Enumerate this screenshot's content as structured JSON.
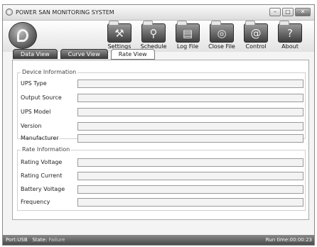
{
  "window": {
    "title": "POWER SAN MONITORING SYSTEM",
    "controls": [
      {
        "name": "minimize",
        "glyph": "–"
      },
      {
        "name": "maximize",
        "glyph": "□"
      },
      {
        "name": "close",
        "glyph": "✕"
      }
    ]
  },
  "toolbar": {
    "items": [
      {
        "label": "Settings",
        "icon": "settings-icon",
        "glyph": "⚒"
      },
      {
        "label": "Schedule",
        "icon": "schedule-icon",
        "glyph": "⚲"
      },
      {
        "label": "Log File",
        "icon": "log-file-icon",
        "glyph": "▤"
      },
      {
        "label": "Close File",
        "icon": "close-file-icon",
        "glyph": "◎"
      },
      {
        "label": "Control",
        "icon": "control-icon",
        "glyph": "@"
      },
      {
        "label": "About",
        "icon": "about-icon",
        "glyph": "?"
      }
    ]
  },
  "tabs": [
    {
      "label": "Data View",
      "active": false
    },
    {
      "label": "Curve View",
      "active": false
    },
    {
      "label": "Rate View",
      "active": true
    }
  ],
  "device_info": {
    "title": "Device Information",
    "fields": [
      {
        "label": "UPS Type",
        "value": ""
      },
      {
        "label": "Output Source",
        "value": ""
      },
      {
        "label": "UPS Model",
        "value": ""
      },
      {
        "label": "Version",
        "value": ""
      },
      {
        "label": "Manufacturer",
        "value": ""
      }
    ]
  },
  "rate_info": {
    "title": "Rate Information",
    "fields": [
      {
        "label": "Rating Voltage",
        "value": ""
      },
      {
        "label": "Rating Current",
        "value": ""
      },
      {
        "label": "Battery Voltage",
        "value": ""
      },
      {
        "label": "Frequency",
        "value": ""
      }
    ]
  },
  "status": {
    "port_label": "Port:",
    "port_value": "USB",
    "state_label": "State:",
    "state_value": "Failure",
    "runtime_label": "Run time:",
    "runtime_value": "00:00:23"
  }
}
